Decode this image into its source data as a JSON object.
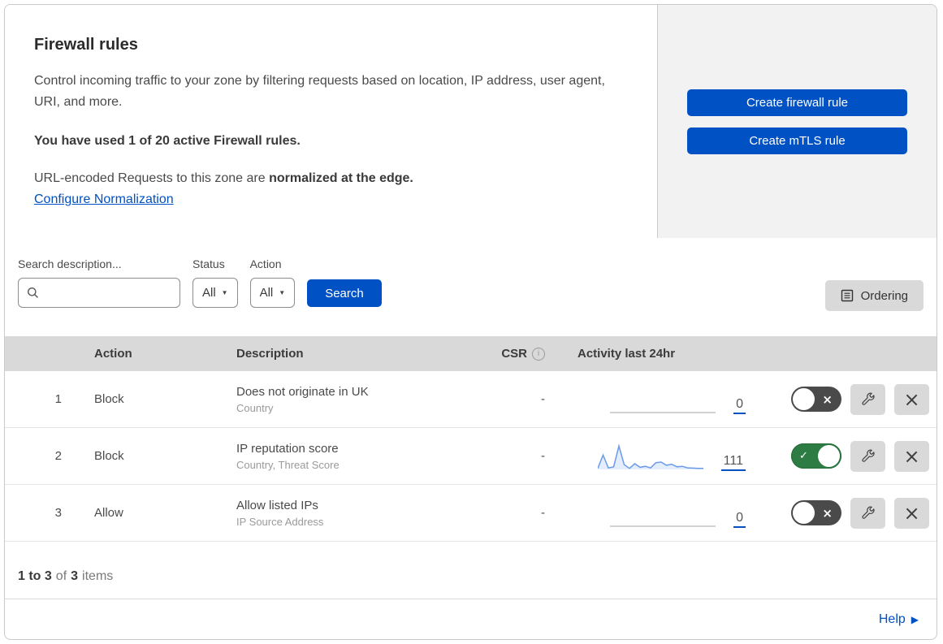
{
  "header": {
    "title": "Firewall rules",
    "description": "Control incoming traffic to your zone by filtering requests based on location, IP address, user agent, URI, and more.",
    "usage_line": "You have used 1 of 20 active Firewall rules.",
    "normalization_text": "URL-encoded Requests to this zone are ",
    "normalization_bold": "normalized at the edge.",
    "normalization_link": "Configure Normalization",
    "create_firewall_button": "Create firewall rule",
    "create_mtls_button": "Create mTLS rule"
  },
  "filters": {
    "search_label": "Search description...",
    "search_value": "",
    "status_label": "Status",
    "status_value": "All",
    "action_label": "Action",
    "action_value": "All",
    "search_button": "Search",
    "ordering_button": "Ordering"
  },
  "table": {
    "columns": {
      "action": "Action",
      "description": "Description",
      "csr": "CSR",
      "activity": "Activity last 24hr"
    },
    "rows": [
      {
        "index": "1",
        "action": "Block",
        "description": "Does not originate in UK",
        "fields": "Country",
        "csr": "-",
        "activity_count": "0",
        "enabled": false,
        "sparkline": []
      },
      {
        "index": "2",
        "action": "Block",
        "description": "IP reputation score",
        "fields": "Country, Threat Score",
        "csr": "-",
        "activity_count": "111",
        "enabled": true,
        "sparkline": [
          4,
          55,
          6,
          10,
          90,
          18,
          4,
          22,
          8,
          12,
          6,
          26,
          28,
          16,
          20,
          10,
          12,
          6,
          5,
          4,
          4
        ]
      },
      {
        "index": "3",
        "action": "Allow",
        "description": "Allow listed IPs",
        "fields": "IP Source Address",
        "csr": "-",
        "activity_count": "0",
        "enabled": false,
        "sparkline": []
      }
    ]
  },
  "footer": {
    "range": "1 to 3",
    "of": "of",
    "total": "3",
    "items": "items"
  },
  "help": {
    "label": "Help"
  },
  "colors": {
    "accent_blue": "#0051c3",
    "toggle_on_green": "#2d7c43",
    "toggle_off_gray": "#4a4a4a",
    "sparkline_blue": "#6b9be8",
    "table_header_gray": "#d9d9d9",
    "panel_gray": "#f2f2f2"
  }
}
